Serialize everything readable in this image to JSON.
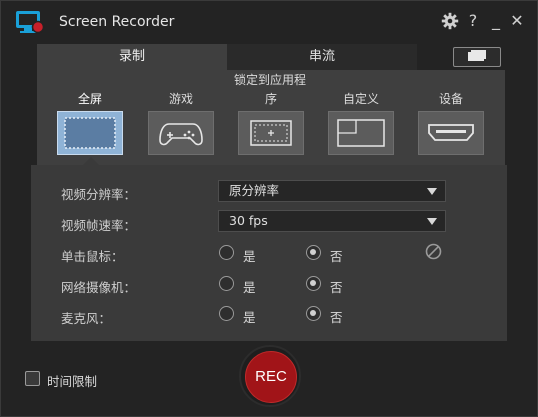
{
  "app": {
    "title": "Screen Recorder",
    "logo_icon": "screen-recorder-logo",
    "accent_color": "#1aa0d8"
  },
  "titlebar": {
    "settings_icon": "gear-icon",
    "help_label": "?",
    "minimize_label": "_",
    "close_label": "✕"
  },
  "tabs": [
    {
      "label": "录制",
      "selected": true
    },
    {
      "label": "串流",
      "selected": false
    }
  ],
  "modes": {
    "items": [
      {
        "label": "全屏",
        "icon": "fullscreen-icon",
        "selected": true
      },
      {
        "label": "游戏",
        "icon": "gamepad-icon",
        "selected": false
      },
      {
        "label_line1": "锁定到应用程",
        "label_line2": "序",
        "icon": "lock-app-icon",
        "selected": false
      },
      {
        "label": "自定义",
        "icon": "custom-area-icon",
        "selected": false
      },
      {
        "label": "设备",
        "icon": "hdmi-icon",
        "selected": false
      }
    ]
  },
  "settings": {
    "resolution": {
      "label": "视频分辨率：",
      "value": "原分辨率"
    },
    "framerate": {
      "label": "视频帧速率：",
      "value": "30 fps"
    },
    "click_mouse": {
      "label": "单击鼠标：",
      "yes": "是",
      "no": "否",
      "selected": "no"
    },
    "webcam": {
      "label": "网络摄像机：",
      "yes": "是",
      "no": "否",
      "selected": "no"
    },
    "microphone": {
      "label": "麦克风：",
      "yes": "是",
      "no": "否",
      "selected": "no"
    }
  },
  "footer": {
    "time_limit_label": "时间限制",
    "time_limit_checked": false,
    "rec_label": "REC",
    "rec_color": "#a11418"
  }
}
